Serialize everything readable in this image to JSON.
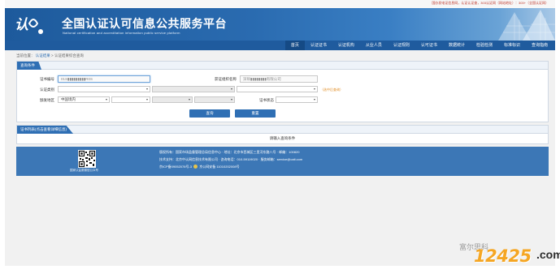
{
  "top_notice": "国办发电证信息网，认证认证查，303认证网（网站地址）：303+（全国认证网）",
  "header": {
    "logo_text": "认",
    "title": "全国认证认可信息公共服务平台",
    "subtitle": "National certification and accreditation information public service platform"
  },
  "nav": {
    "items": [
      "首页",
      "认证证书",
      "认证机构",
      "从业人员",
      "认证规则",
      "认可证书",
      "数据统计",
      "检验检测",
      "标准标识",
      "查询指南"
    ]
  },
  "breadcrumb": {
    "prefix": "当前位置：",
    "link": "认证结果",
    "separator": ">",
    "current": "认证结果综合查询"
  },
  "form": {
    "tab": "查询条件",
    "cert_no_label": "证书编号",
    "cert_no_value": "01S▮▮▮▮▮▮▮▮▮R0S",
    "org_name_label": "获证组织名称",
    "org_name_value": "深圳▮▮▮▮▮▮▮▮有限公司",
    "cert_type_label": "认证类别",
    "region_label": "颁发地区",
    "region_value": "中国境内",
    "status_label": "证书状态",
    "hint": "（选中后查询）",
    "query_button": "查询",
    "reset_button": "重置"
  },
  "results": {
    "tab": "证书列表(点击查看详细信息)",
    "empty": "请输入查询条件"
  },
  "footer": {
    "qr_caption": "国家认监委微信公众号",
    "line1": "版权所有：国家市场监督管理总局信息中心 · 地址：北京市西城区三里河东路八号 · 邮编：100820",
    "line2": "技术支持：北京中认网信息技术有限公司 · 咨询电话：010-59119020 · 服务邮箱：service@cait.com",
    "line3_icp": "京ICP备09052078号-3",
    "line3_police": "京公网安备 11010202008号"
  },
  "watermark": {
    "top": "富尔思科",
    "number": "12425",
    "suffix": ".com"
  }
}
